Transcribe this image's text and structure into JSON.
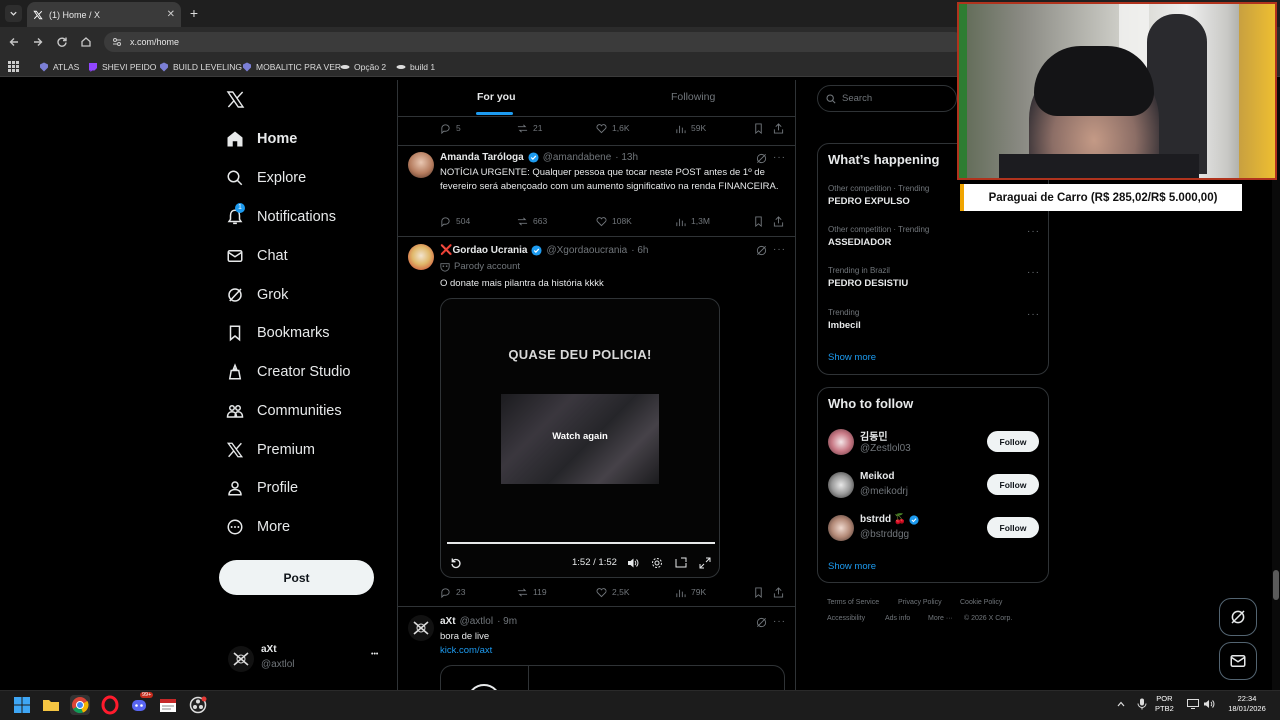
{
  "browser": {
    "tab_title": "(1) Home / X",
    "url": "x.com/home",
    "bookmarks": [
      "ATLAS",
      "SHEVI PEIDO",
      "BUILD LEVELING",
      "MOBALITIC PRA VER",
      "Opção 2",
      "build 1"
    ]
  },
  "nav": {
    "items": [
      "Home",
      "Explore",
      "Notifications",
      "Chat",
      "Grok",
      "Bookmarks",
      "Creator Studio",
      "Communities",
      "Premium",
      "Profile",
      "More"
    ],
    "notification_badge": "1",
    "post_label": "Post",
    "account_name": "aXt",
    "account_handle": "@axtlol",
    "more_dots": "•••"
  },
  "feed": {
    "tabs": [
      "For you",
      "Following"
    ],
    "prev_actions": {
      "replies": "5",
      "reposts": "21",
      "likes": "1,6K",
      "views": "59K"
    },
    "posts": [
      {
        "name": "Amanda Taróloga",
        "handle": "@amandabene",
        "time": "· 13h",
        "text": "NOTÍCIA URGENTE: Qualquer pessoa que tocar neste POST antes de 1º de fevereiro será abençoado com um aumento significativo na renda FINANCEIRA.",
        "replies": "504",
        "reposts": "663",
        "likes": "108K",
        "views": "1,3M"
      },
      {
        "name": "❌Gordao Ucrania",
        "handle": "@Xgordaoucrania",
        "time": "· 6h",
        "label": "Parody account",
        "text": "O donate mais pilantra da história kkkk",
        "video_title": "QUASE DEU POLICIA!",
        "video_overlay": "Watch again",
        "video_time": "1:52 / 1:52",
        "replies": "23",
        "reposts": "119",
        "likes": "2,5K",
        "views": "79K"
      },
      {
        "name": "aXt",
        "handle": "@axtlol",
        "time": "· 9m",
        "text": "bora de live",
        "link": "kick.com/axt"
      }
    ]
  },
  "right": {
    "search_placeholder": "Search",
    "happening_title": "What’s happening",
    "trends": [
      {
        "context": "Other competition · Trending",
        "name": "PEDRO EXPULSO"
      },
      {
        "context": "Other competition · Trending",
        "name": "ASSEDIADOR"
      },
      {
        "context": "Trending in Brazil",
        "name": "PEDRO DESISTIU"
      },
      {
        "context": "Trending",
        "name": "Imbecil"
      }
    ],
    "show_more": "Show more",
    "wtf_title": "Who to follow",
    "follow_suggestions": [
      {
        "name": "김동민",
        "handle": "@Zestlol03"
      },
      {
        "name": "Meikod",
        "handle": "@meikodrj"
      },
      {
        "name": "bstrdd 🍒",
        "handle": "@bstrddgg"
      }
    ],
    "follow_label": "Follow",
    "footer": [
      "Terms of Service",
      "Privacy Policy",
      "Cookie Policy",
      "Accessibility",
      "Ads info",
      "More ···",
      "© 2026 X Corp."
    ]
  },
  "overlay": {
    "ticker": "Paraguai de Carro (R$ 285,02/R$ 5.000,00)"
  },
  "taskbar": {
    "lang_top": "POR",
    "lang_bottom": "PTB2",
    "time": "22:34",
    "date": "18/01/2026",
    "badge_discord": "99+"
  },
  "colors": {
    "accent": "#1d9bf0",
    "background": "#000000",
    "button_light": "#eff3f4",
    "ticker_accent": "#f0a500"
  }
}
